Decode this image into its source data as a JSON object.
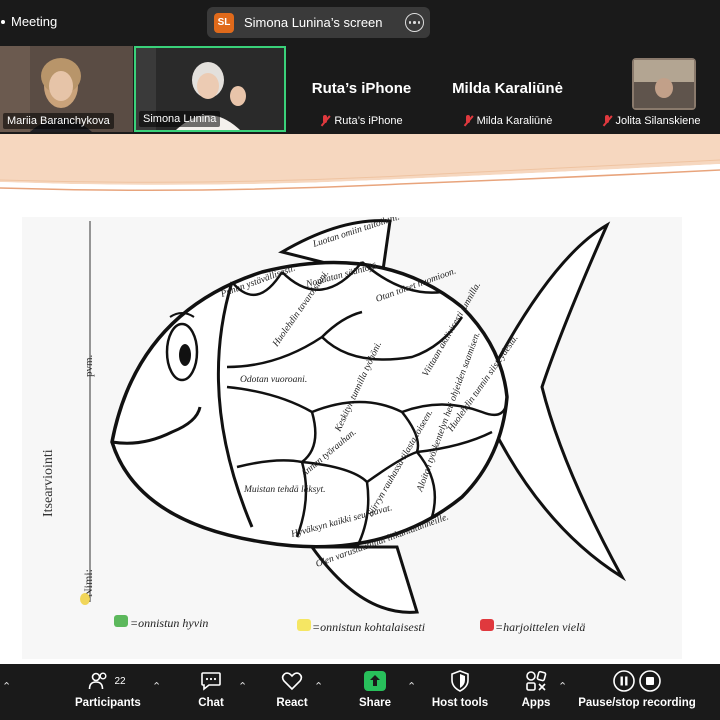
{
  "meeting": {
    "title": "Meeting"
  },
  "share": {
    "badge": "SL",
    "label": "Simona Lunina’s screen"
  },
  "participants": [
    {
      "name": "Mariia Baranchykova",
      "muted": false
    },
    {
      "name": "Simona Lunina",
      "muted": false,
      "active": true
    },
    {
      "name": "Ruta’s iPhone",
      "muted": true
    },
    {
      "name": "Milda Karaliūnė",
      "muted": true
    },
    {
      "name": "Jolita Silanskiene",
      "muted": true
    }
  ],
  "worksheet": {
    "title": "Itsearviointi",
    "name_label": "Nimi:",
    "date_label": "pvm.",
    "scales": [
      "Luotan omiin taitoihini.",
      "Puhun ystävällisesti.",
      "Noudatan sääntöjä.",
      "Otan toiset huomioon.",
      "Huolehdin tavaroistani.",
      "Odotan vuoroani.",
      "Keskityn tunnilla työhöni.",
      "Viittaan aktiivisesti tunnilla.",
      "Huolehdin tunnin siisteydestä.",
      "Annan työrauhan.",
      "Muistan tehdä läksyt.",
      "Siirryn rauhassa tilasta toiseen.",
      "Aloitan työskentelyn heti ohjeiden saamisen.",
      "Hyväksyn kaikki seuraavat.",
      "Olen varustautunut liikuntatunneille."
    ],
    "legend": [
      {
        "label": "=onnistun hyvin",
        "color": "#5cb85c"
      },
      {
        "label": "=onnistun kohtalaisesti",
        "color": "#f5e663"
      },
      {
        "label": "=harjoittelen vielä",
        "color": "#e0393e"
      }
    ]
  },
  "toolbar": {
    "participants": {
      "label": "Participants",
      "count": "22"
    },
    "chat": {
      "label": "Chat"
    },
    "react": {
      "label": "React"
    },
    "share": {
      "label": "Share"
    },
    "host_tools": {
      "label": "Host tools"
    },
    "apps": {
      "label": "Apps"
    },
    "recording": {
      "label": "Pause/stop recording"
    }
  }
}
